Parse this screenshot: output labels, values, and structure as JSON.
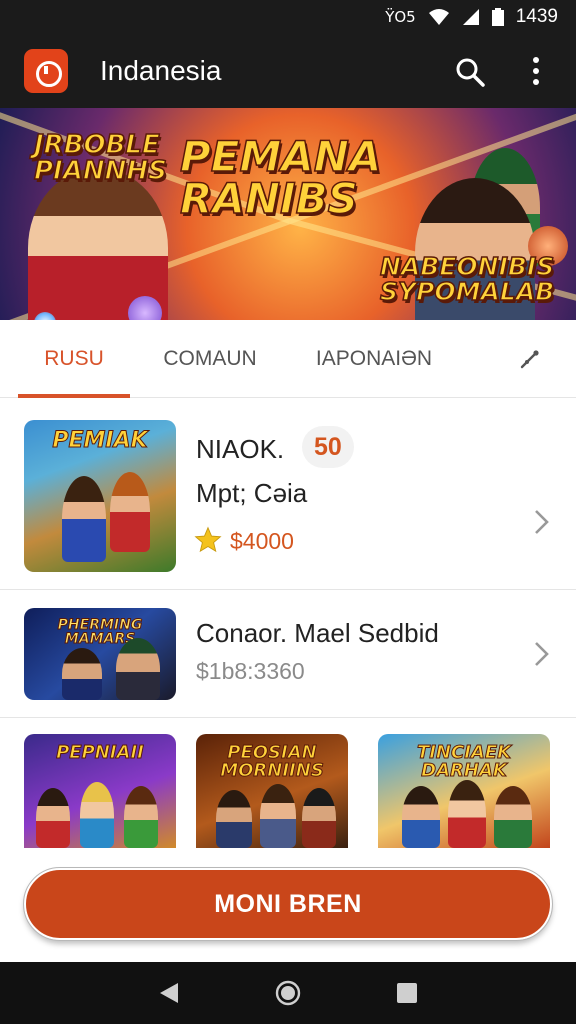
{
  "status_bar": {
    "signal": "ΫΟ5",
    "time": "1439",
    "icons": [
      "wifi-icon",
      "signal-icon",
      "battery-icon"
    ]
  },
  "app_bar": {
    "title": "Indanesia",
    "icons": [
      "app-logo-icon",
      "search-icon",
      "more-vert-icon"
    ]
  },
  "banner": {
    "logo_left": "JRBOBLE PIANNHS",
    "logo_center": "PEMANA RANIBS",
    "logo_right": "NABEONIBIS SYPOMALAB"
  },
  "tabs": [
    {
      "label": "RUSU",
      "active": true
    },
    {
      "label": "COMAUN",
      "active": false
    },
    {
      "label": "IAPONAIƏN",
      "active": false
    }
  ],
  "tab_more_icon": "share-icon",
  "items": [
    {
      "thumb_title": "PEMIAK",
      "title": "NIAOK.",
      "badge": "50",
      "subtitle": "Mpt; Cəia",
      "rating_icon": "star-icon",
      "price": "$4000"
    },
    {
      "thumb_title": "PHERMING MAMARS",
      "title": "Conaor. Mael Sedbid",
      "price": "$1b8:3360"
    }
  ],
  "grid": [
    {
      "title": "PEPNIAII"
    },
    {
      "title": "PEOSIAN MORNIINS"
    },
    {
      "title": "TINCIAEK DARHAK"
    }
  ],
  "cta": {
    "label": "MONI BREN"
  },
  "colors": {
    "accent": "#d8532a",
    "cta": "#c9461a",
    "dark_bar": "#1b1b1b",
    "star": "#f4c21d"
  }
}
